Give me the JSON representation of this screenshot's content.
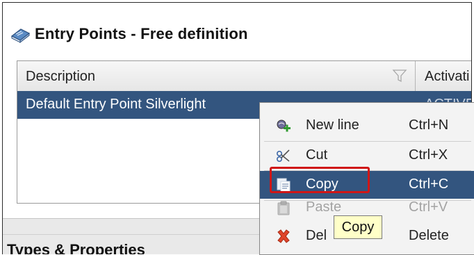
{
  "window": {
    "title": "Entry Points - Free definition",
    "title_icon": "book-icon"
  },
  "grid": {
    "columns": [
      "Description",
      "Activati"
    ],
    "rows": [
      {
        "description": "Default Entry Point Silverlight",
        "activation": "ACTIVE"
      }
    ],
    "selected_row_color": "#33557f"
  },
  "context_menu": {
    "items": [
      {
        "label": "New line",
        "shortcut": "Ctrl+N",
        "icon": "new-line-icon",
        "enabled": true
      },
      {
        "label": "Cut",
        "shortcut": "Ctrl+X",
        "icon": "scissors-icon",
        "enabled": true
      },
      {
        "label": "Copy",
        "shortcut": "Ctrl+C",
        "icon": "copy-icon",
        "enabled": true,
        "highlighted": true
      },
      {
        "label": "Paste",
        "shortcut": "Ctrl+V",
        "icon": "clipboard-icon",
        "enabled": false
      },
      {
        "label": "Del",
        "shortcut": "Delete",
        "icon": "delete-icon",
        "enabled": true
      }
    ],
    "highlight_color": "#33557f"
  },
  "tooltip": {
    "text": "Copy"
  },
  "lower_panel": {
    "section_title": "Types & Properties"
  },
  "annotation": {
    "color": "#d01616"
  }
}
